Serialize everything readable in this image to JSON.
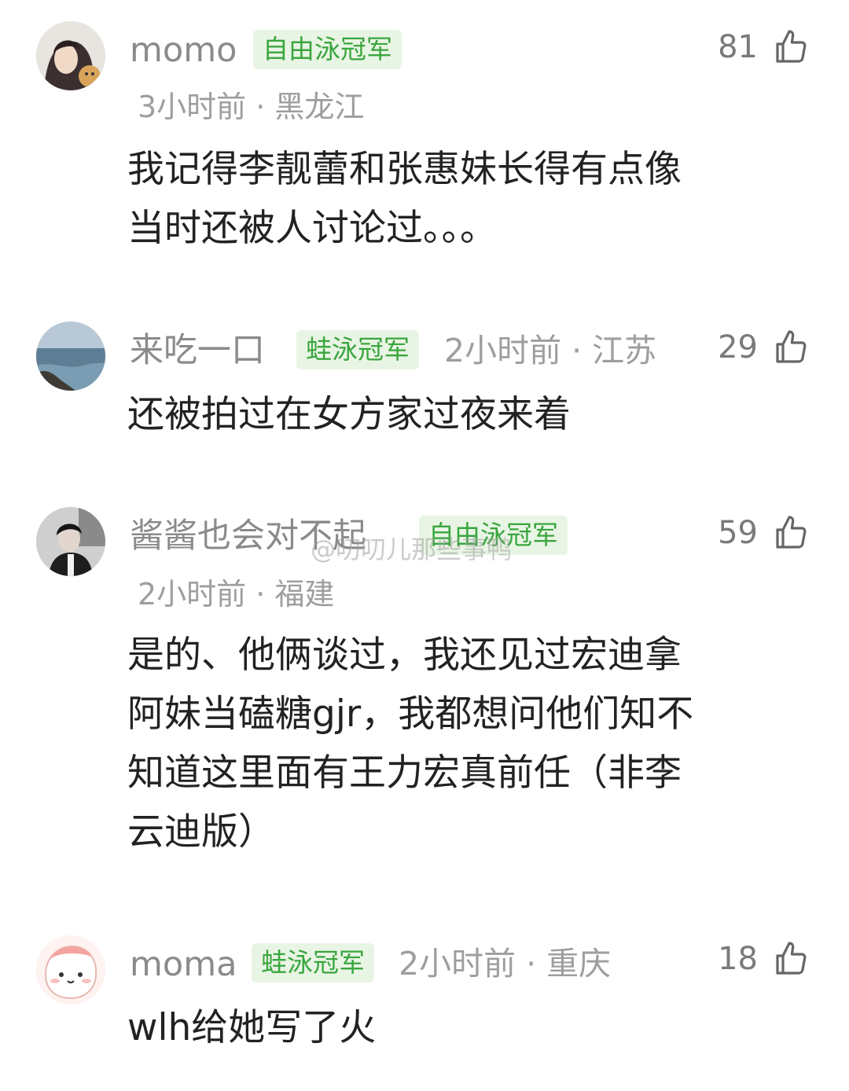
{
  "colors": {
    "badge_bg": "#e9f5e4",
    "badge_text": "#3aa63f",
    "muted": "#9e9e9e",
    "text": "#222222"
  },
  "watermark": "@叨叨儿那些事鸭",
  "comments": [
    {
      "user": "momo",
      "badge": "自由泳冠军",
      "meta": "3小时前 · 黑龙江",
      "likes": "81",
      "text": "我记得李靓蕾和张惠妹长得有点像\n当时还被人讨论过。。。",
      "avatar_icon": "anime-avatar-icon"
    },
    {
      "user": "来吃一口",
      "badge": "蛙泳冠军",
      "meta": "2小时前 · 江苏",
      "likes": "29",
      "text": "还被拍过在女方家过夜来着",
      "avatar_icon": "seascape-avatar-icon"
    },
    {
      "user": "酱酱也会对不起",
      "badge": "自由泳冠军",
      "meta": "2小时前 · 福建",
      "likes": "59",
      "text": "是的、他俩谈过，我还见过宏迪拿\n阿妹当磕糖gjr，我都想问他们知不\n知道这里面有王力宏真前任（非李\n云迪版）",
      "avatar_icon": "portrait-avatar-icon"
    },
    {
      "user": "moma",
      "badge": "蛙泳冠军",
      "meta": "2小时前 · 重庆",
      "likes": "18",
      "text": "wlh给她写了火",
      "avatar_icon": "cartoon-avatar-icon"
    }
  ]
}
